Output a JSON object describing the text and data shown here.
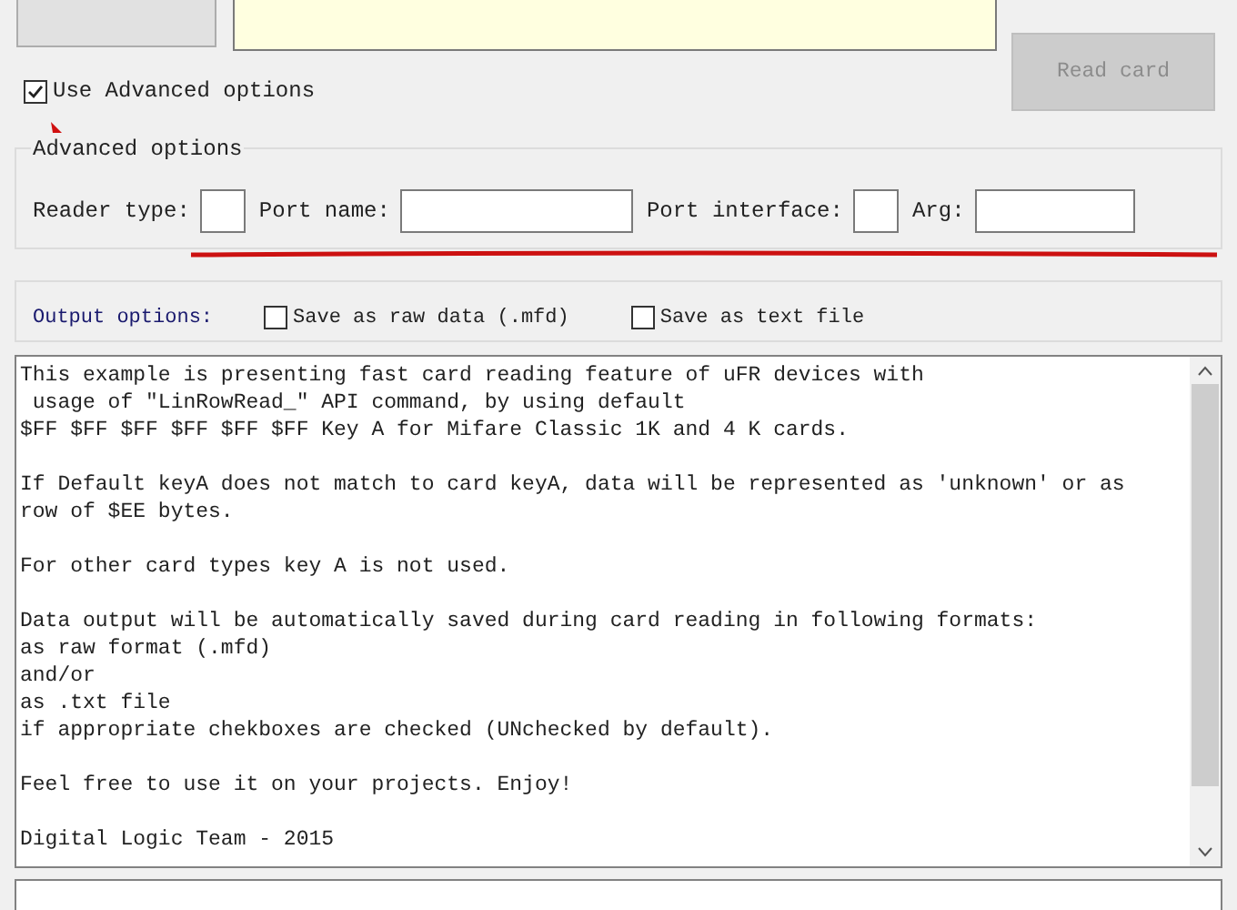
{
  "read_card_button": {
    "label": "Read card",
    "disabled": true
  },
  "use_advanced": {
    "label": "Use Advanced options",
    "checked": true
  },
  "advanced_options": {
    "title": "Advanced options",
    "fields": [
      {
        "label": "Reader type:"
      },
      {
        "label": "Port name:"
      },
      {
        "label": "Port interface:"
      },
      {
        "label": "Arg:"
      }
    ]
  },
  "output_options": {
    "title": "Output options:",
    "checkboxes": [
      {
        "label": "Save as raw data (.mfd)",
        "checked": false
      },
      {
        "label": "Save as text file",
        "checked": false
      }
    ]
  },
  "log_text": {
    "paragraphs": [
      [
        "This example is presenting fast card reading feature of uFR devices with",
        " usage of \"LinRowRead_\" API command, by using default",
        "$FF $FF $FF $FF $FF $FF Key A for Mifare Classic 1K and 4 K cards."
      ],
      [
        "If Default keyA does not match to card keyA, data will be represented as 'unknown' or as",
        "row of $EE bytes."
      ],
      [
        "For other card types key A is not used."
      ],
      [
        "Data output will be automatically saved during card reading in following formats:",
        "as raw format (.mfd)",
        "and/or",
        "as .txt file",
        "if appropriate chekboxes are checked (UNchecked by default)."
      ],
      [
        "Feel free to use it on your projects. Enjoy!"
      ],
      [
        "Digital Logic Team - 2015"
      ]
    ]
  }
}
